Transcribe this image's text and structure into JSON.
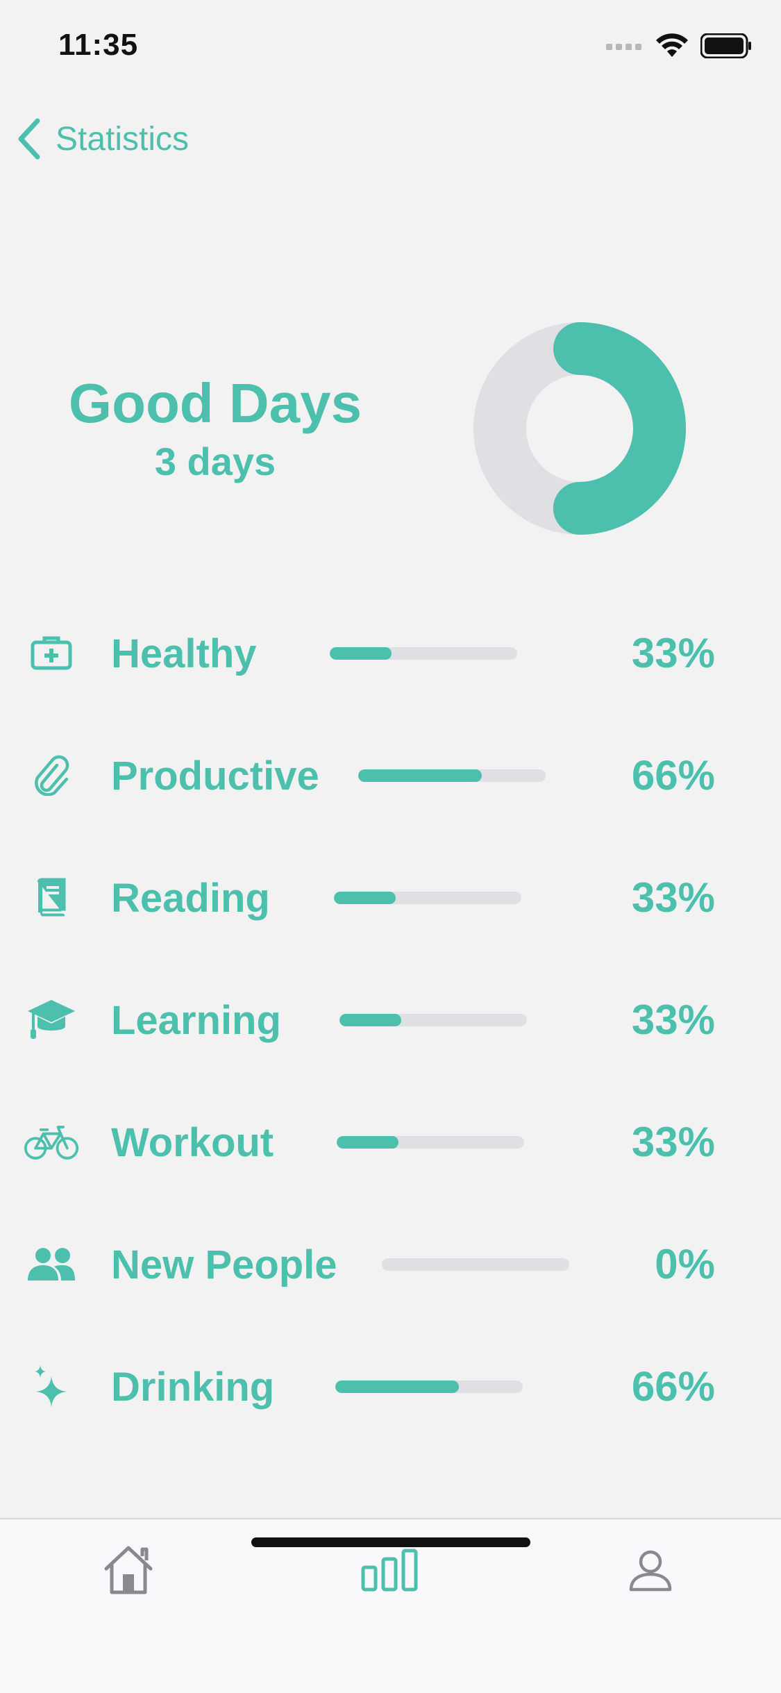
{
  "status_bar": {
    "time": "11:35"
  },
  "nav": {
    "back_label": "Statistics"
  },
  "summary": {
    "title": "Good Days",
    "subtitle": "3 days",
    "ring_fraction": 0.5,
    "ring_colors": {
      "fill": "#4dbfad",
      "track": "#e0dfe4"
    }
  },
  "stats": [
    {
      "icon": "first-aid-kit-icon",
      "label": "Healthy",
      "percent_text": "33%",
      "value": 0.33
    },
    {
      "icon": "paperclip-icon",
      "label": "Productive",
      "percent_text": "66%",
      "value": 0.66
    },
    {
      "icon": "book-icon",
      "label": "Reading",
      "percent_text": "33%",
      "value": 0.33
    },
    {
      "icon": "graduation-cap-icon",
      "label": "Learning",
      "percent_text": "33%",
      "value": 0.33
    },
    {
      "icon": "bicycle-icon",
      "label": "Workout",
      "percent_text": "33%",
      "value": 0.33
    },
    {
      "icon": "people-icon",
      "label": "New People",
      "percent_text": "0%",
      "value": 0.0
    },
    {
      "icon": "sparkles-icon",
      "label": "Drinking",
      "percent_text": "66%",
      "value": 0.66
    }
  ],
  "tab_bar": {
    "tabs": [
      {
        "icon": "home-icon",
        "selected": false
      },
      {
        "icon": "bar-chart-icon",
        "selected": true
      },
      {
        "icon": "person-icon",
        "selected": false
      }
    ]
  },
  "colors": {
    "accent": "#4dbfad",
    "track": "#e0dfe4",
    "background": "#f2f2f2",
    "inactive": "#8a8a8e"
  }
}
